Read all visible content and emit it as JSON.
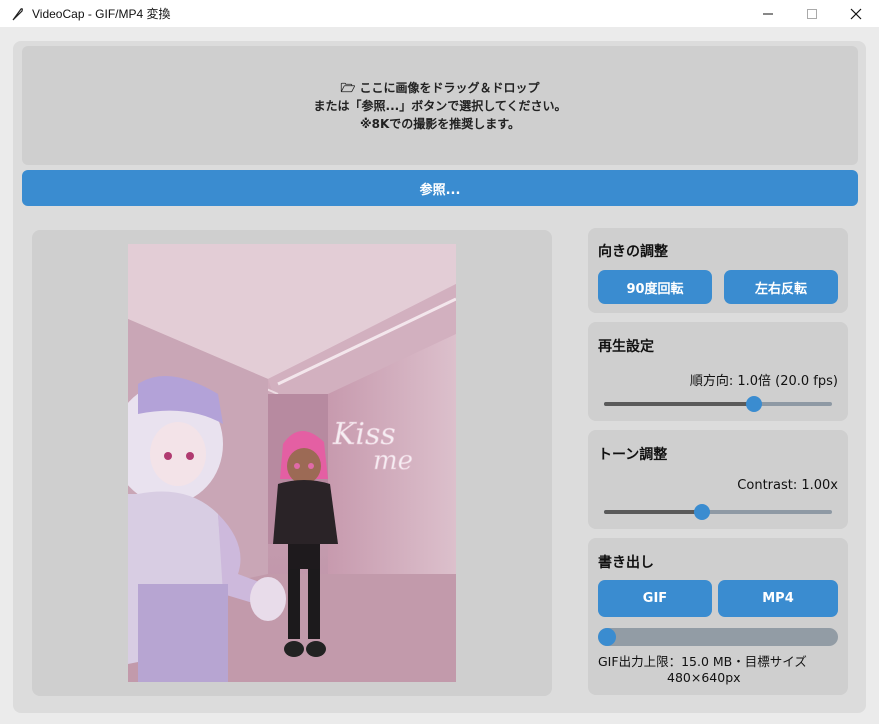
{
  "window": {
    "title": "VideoCap - GIF/MP4 変換"
  },
  "dropzone": {
    "line1": "🗁 ここに画像をドラッグ＆ドロップ",
    "line2": "または「参照...」ボタンで選択してください。",
    "line3": "※8Kでの撮影を推奨します。"
  },
  "browse_label": "参照...",
  "preview": {
    "sign_text": "Kiss me"
  },
  "orientation": {
    "title": "向きの調整",
    "rotate_label": "90度回転",
    "flip_label": "左右反転"
  },
  "playback": {
    "title": "再生設定",
    "value_text": "順方向: 1.0倍 (20.0 fps)",
    "slider_fraction": 0.66
  },
  "tone": {
    "title": "トーン調整",
    "value_text": "Contrast: 1.00x",
    "slider_fraction": 0.43
  },
  "export": {
    "title": "書き出し",
    "gif_label": "GIF",
    "mp4_label": "MP4",
    "progress_fraction": 0.0,
    "note_line1": "GIF出力上限：15.0 MB・目標サイズ",
    "note_line2": "480×640px"
  },
  "colors": {
    "accent": "#3a8cd0",
    "panel": "#cfcfcf",
    "background": "#dcdcdc"
  },
  "icons": {
    "app": "feather-icon",
    "folder": "folder-icon"
  }
}
